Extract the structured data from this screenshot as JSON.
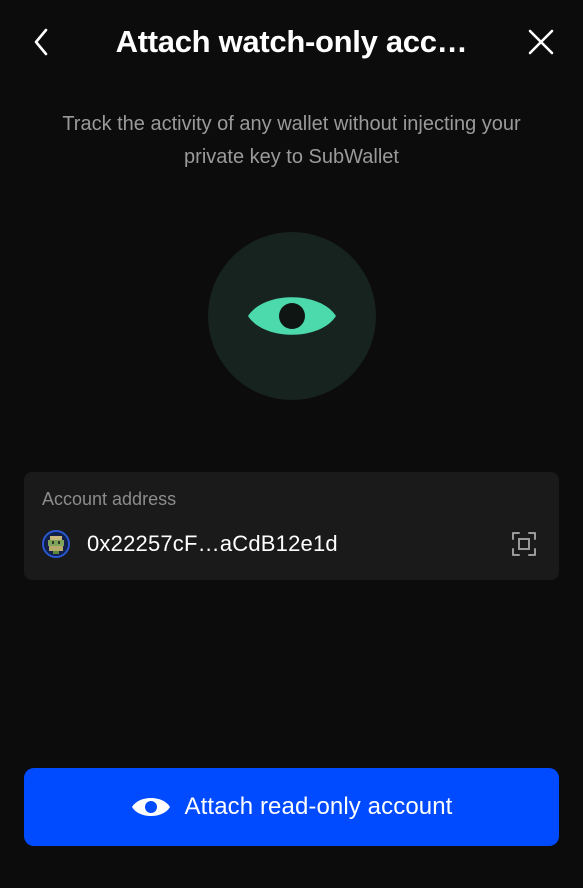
{
  "header": {
    "title": "Attach watch-only acc…",
    "back_icon": "chevron-left-icon",
    "close_icon": "close-icon"
  },
  "subtitle": "Track the activity of any wallet without injecting your private key to SubWallet",
  "hero": {
    "icon": "eye-icon",
    "accent_color": "#4cd9ac",
    "circle_color": "#17231f"
  },
  "address_field": {
    "label": "Account address",
    "value": "0x22257cF…aCdB12e1d",
    "avatar_icon": "account-avatar-icon",
    "scan_icon": "scan-qr-icon"
  },
  "primary_button": {
    "label": "Attach read-only account",
    "icon": "eye-icon",
    "color": "#004bff"
  }
}
